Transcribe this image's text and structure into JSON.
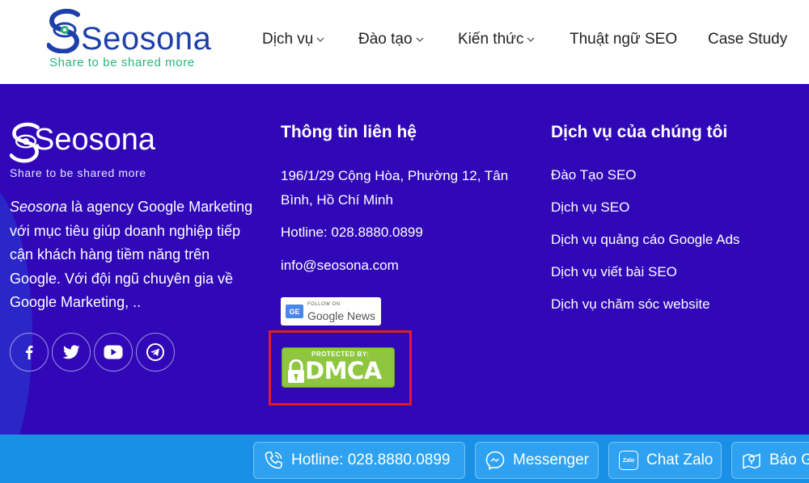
{
  "header": {
    "logo": {
      "wordmark": "Seosona",
      "tagline": "Share to be shared more"
    },
    "nav": [
      {
        "label": "Dịch vụ",
        "has_dropdown": true
      },
      {
        "label": "Đào tạo",
        "has_dropdown": true
      },
      {
        "label": "Kiến thức",
        "has_dropdown": true
      },
      {
        "label": "Thuật ngữ SEO",
        "has_dropdown": false
      },
      {
        "label": "Case Study",
        "has_dropdown": false
      }
    ]
  },
  "footer": {
    "logo": {
      "wordmark": "Seosona",
      "tagline": "Share to be shared more"
    },
    "about": {
      "brand": "Seosona",
      "text": " là agency Google Marketing với mục tiêu giúp doanh nghiệp tiếp cận khách hàng tiềm năng trên Google. Với đội ngũ chuyên gia về Google Marketing, .."
    },
    "socials": [
      "facebook-icon",
      "twitter-icon",
      "youtube-icon",
      "telegram-icon"
    ],
    "contact": {
      "title": "Thông tin liên hệ",
      "address": "196/1/29 Cộng Hòa, Phường 12, Tân Bình, Hồ Chí Minh",
      "hotline": "Hotline: 028.8880.0899",
      "email": "info@seosona.com",
      "gnews_small": "FOLLOW ON",
      "gnews_big": "Google News",
      "gnews_badge": "GE",
      "dmca_top": "PROTECTED BY:",
      "dmca_main": "DMCA"
    },
    "services": {
      "title": "Dịch vụ của chúng tôi",
      "items": [
        "Đào Tạo SEO",
        "Dịch vụ SEO",
        "Dịch vụ quảng cáo Google Ads",
        "Dịch vụ viết bài SEO",
        "Dịch vụ chăm sóc website"
      ]
    }
  },
  "contact_bar": {
    "hotline": "Hotline: 028.8880.0899",
    "messenger": "Messenger",
    "zalo": "Chat Zalo",
    "zalo_badge": "Zalo",
    "report": "Báo G"
  },
  "colors": {
    "footer_bg": "#3008b8",
    "bar_bg": "#1a8fe6",
    "accent_green": "#27b57a",
    "brand_blue": "#1c3faa",
    "dmca_green": "#8ec63f",
    "highlight_red": "#e21a2a"
  }
}
